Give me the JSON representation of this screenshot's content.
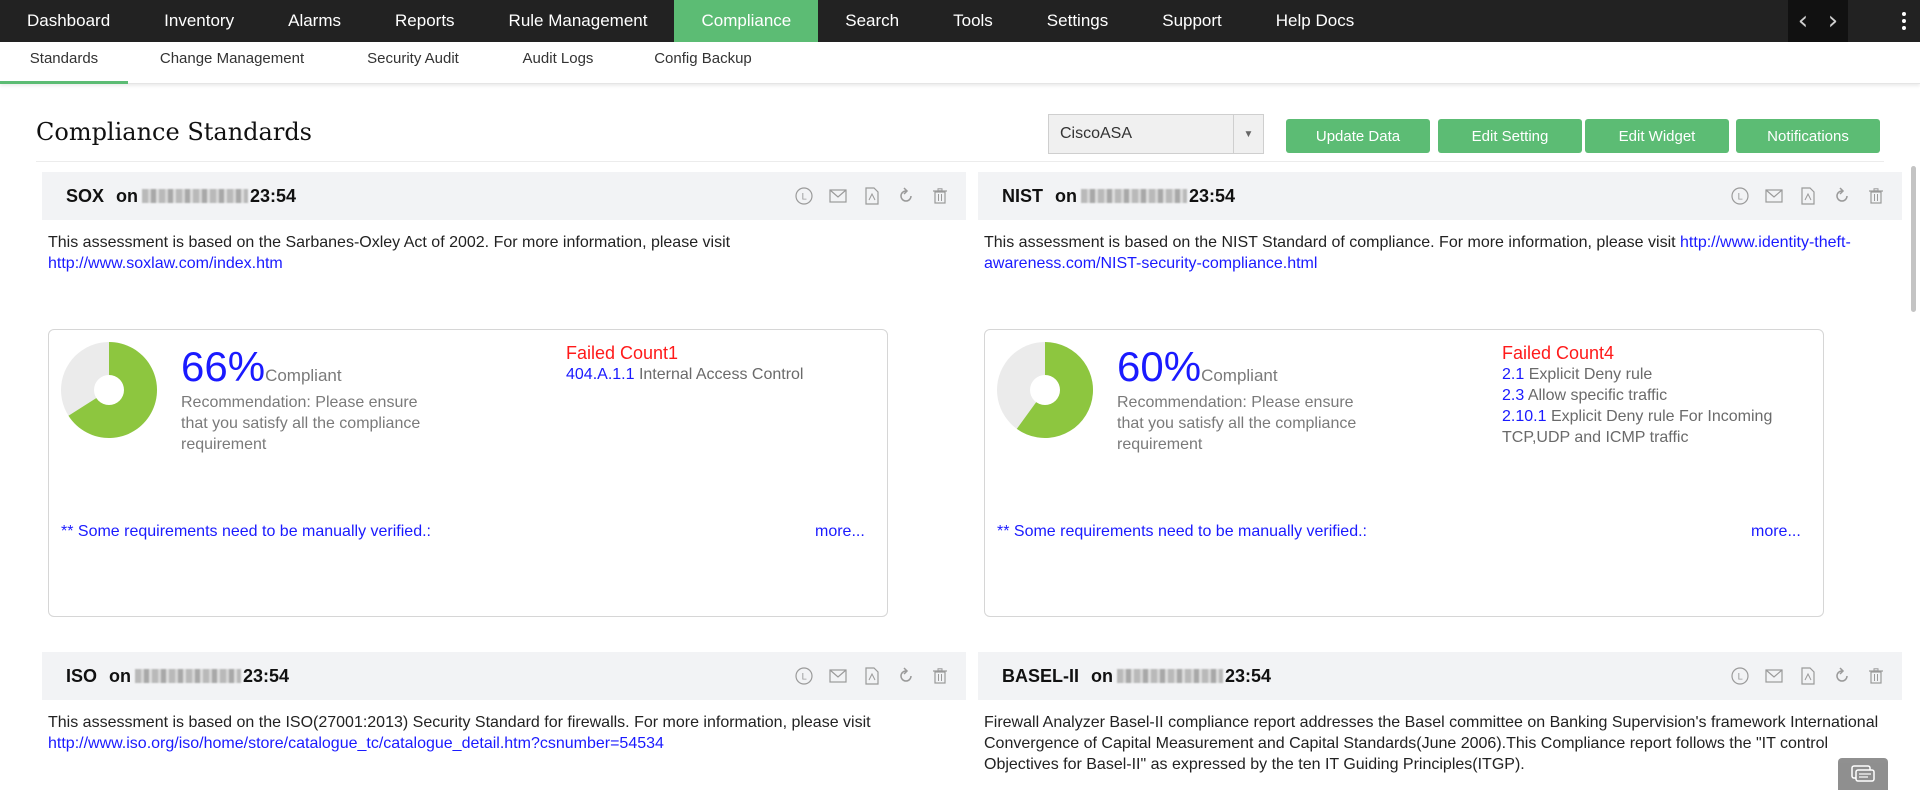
{
  "topnav": {
    "items": [
      {
        "label": "Dashboard"
      },
      {
        "label": "Inventory"
      },
      {
        "label": "Alarms"
      },
      {
        "label": "Reports"
      },
      {
        "label": "Rule Management"
      },
      {
        "label": "Compliance"
      },
      {
        "label": "Search"
      },
      {
        "label": "Tools"
      },
      {
        "label": "Settings"
      },
      {
        "label": "Support"
      },
      {
        "label": "Help Docs"
      }
    ],
    "active": "Compliance",
    "prev_icon": "chevron-left-icon",
    "next_icon": "chevron-right-icon",
    "menu_icon": "kebab-menu-icon"
  },
  "subnav": {
    "items": [
      {
        "label": "Standards"
      },
      {
        "label": "Change Management"
      },
      {
        "label": "Security Audit"
      },
      {
        "label": "Audit Logs"
      },
      {
        "label": "Config Backup"
      }
    ],
    "active": "Standards"
  },
  "header": {
    "title": "Compliance Standards",
    "device_select": {
      "value": "CiscoASA"
    },
    "buttons": {
      "update": "Update Data",
      "edit_setting": "Edit Setting",
      "edit_widget": "Edit Widget",
      "notifications": "Notifications"
    }
  },
  "colors": {
    "accent": "#5cbc74",
    "nav_bg": "#222222",
    "link": "#1a1aff",
    "failed": "#ff1a1a",
    "pie_fill": "#8dc63f",
    "pie_rest": "#ebebeb"
  },
  "card_icons": [
    "schedule-icon",
    "email-icon",
    "pdf-icon",
    "refresh-icon",
    "trash-icon"
  ],
  "cards": {
    "sox": {
      "title": "SOX",
      "on": "on",
      "time": "23:54",
      "desc": "This assessment is based on the Sarbanes-Oxley Act of 2002. For more information, please visit",
      "link": "http://www.soxlaw.com/index.htm",
      "percent_label": "66%",
      "percent_value": 66,
      "compliant": "Compliant",
      "recommendation": "Recommendation: Please ensure that you satisfy all the compliance requirement",
      "failed_title": "Failed Count1",
      "failed_items": [
        {
          "code": "404.A.1.1",
          "text": "Internal Access Control"
        }
      ],
      "manual": "** Some requirements need to be manually verified.:",
      "more": "more..."
    },
    "nist": {
      "title": "NIST",
      "on": "on",
      "time": "23:54",
      "desc": "This assessment is based on the NIST Standard of compliance. For more information, please visit",
      "link": "http://www.identity-theft-awareness.com/NIST-security-compliance.html",
      "percent_label": "60%",
      "percent_value": 60,
      "compliant": "Compliant",
      "recommendation": "Recommendation: Please ensure that you satisfy all the compliance requirement",
      "failed_title": "Failed Count4",
      "failed_items": [
        {
          "code": "2.1",
          "text": "Explicit Deny rule"
        },
        {
          "code": "2.3",
          "text": "Allow specific traffic"
        },
        {
          "code": "2.10.1",
          "text": "Explicit Deny rule For Incoming TCP,UDP and ICMP traffic"
        }
      ],
      "manual": "** Some requirements need to be manually verified.:",
      "more": "more..."
    },
    "iso": {
      "title": "ISO",
      "on": "on",
      "time": "23:54",
      "desc": "This assessment is based on the ISO(27001:2013) Security Standard for firewalls. For more information, please visit",
      "link": "http://www.iso.org/iso/home/store/catalogue_tc/catalogue_detail.htm?csnumber=54534"
    },
    "basel": {
      "title": "BASEL-II",
      "on": "on",
      "time": "23:54",
      "desc": "Firewall Analyzer Basel-II compliance report addresses the Basel committee on Banking Supervision's framework International Convergence of Capital Measurement and Capital Standards(June 2006).This Compliance report follows the \"IT control Objectives for Basel-II\" as expressed by the ten IT Guiding Principles(ITGP)."
    }
  },
  "chat_icon": "chat-icon"
}
